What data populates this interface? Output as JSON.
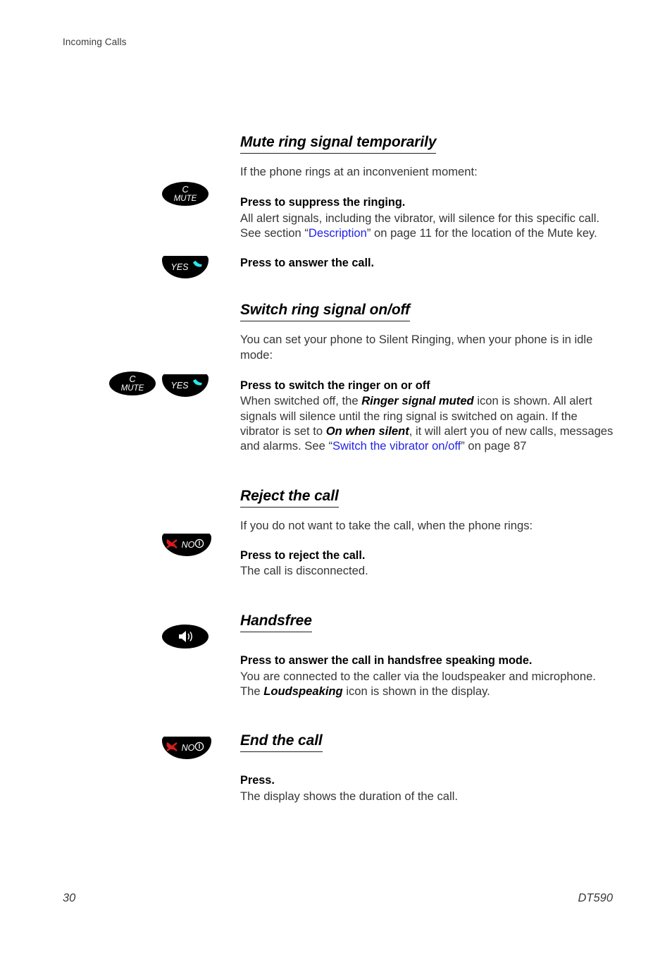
{
  "header": {
    "running_head": "Incoming Calls"
  },
  "footer": {
    "page_number": "30",
    "model": "DT590"
  },
  "colors": {
    "text": "#363636",
    "heading": "#000000",
    "link": "#2323e8",
    "key_body": "#000000",
    "key_label": "#ffffff",
    "handset_answer": "#27e8e8",
    "handset_reject": "#d81d1d"
  },
  "keys": {
    "mute": {
      "label_top": "C",
      "label_bottom": "MUTE",
      "name": "mute-key"
    },
    "yes": {
      "label": "YES",
      "name": "yes-key"
    },
    "no": {
      "label": "NO",
      "name": "no-key"
    },
    "handsfree": {
      "label": "",
      "name": "handsfree-key"
    }
  },
  "sections": [
    {
      "id": "mute-ring-signal-temporarily",
      "title": "Mute ring signal temporarily",
      "intro": "If the phone rings at an inconvenient moment:",
      "blocks": [
        {
          "lead": "Press to suppress the ringing.",
          "body_pre": "All alert signals, including the vibrator, will silence for this specific call. See section “",
          "link": "Description",
          "body_post": "” on page 11 for the location of the Mute key."
        },
        {
          "lead": "Press to answer the call.",
          "body_pre": "",
          "link": "",
          "body_post": ""
        }
      ]
    },
    {
      "id": "switch-ring-signal-on-off",
      "title": "Switch ring signal on/off",
      "intro": "You can set your phone to Silent Ringing, when your phone is in idle mode:",
      "blocks": [
        {
          "lead": "Press to switch the ringer on or off",
          "body_1": "When switched off, the ",
          "emph_1": "Ringer signal muted",
          "body_2": " icon is shown. All alert signals will silence until the ring signal is switched on again. If the vibrator is set to ",
          "emph_2": "On when silent",
          "body_3": ", it will alert you of new calls, messages and alarms. See “",
          "link": "Switch the vibrator on/off",
          "body_4": "” on page 87"
        }
      ]
    },
    {
      "id": "reject-the-call",
      "title": "Reject the call",
      "intro": "If you do not want to take the call, when the phone rings:",
      "blocks": [
        {
          "lead": "Press to reject the call.",
          "body": "The call is disconnected."
        }
      ]
    },
    {
      "id": "handsfree",
      "title": "Handsfree",
      "intro": "",
      "blocks": [
        {
          "lead": "Press to answer the call in handsfree speaking mode.",
          "body_1": "You are connected to the caller via the loudspeaker and microphone. The ",
          "emph_1": "Loudspeaking",
          "body_2": " icon is shown in the display."
        }
      ]
    },
    {
      "id": "end-the-call",
      "title": "End the call",
      "intro": "",
      "blocks": [
        {
          "lead": "Press.",
          "body": "The display shows the duration of the call."
        }
      ]
    }
  ]
}
